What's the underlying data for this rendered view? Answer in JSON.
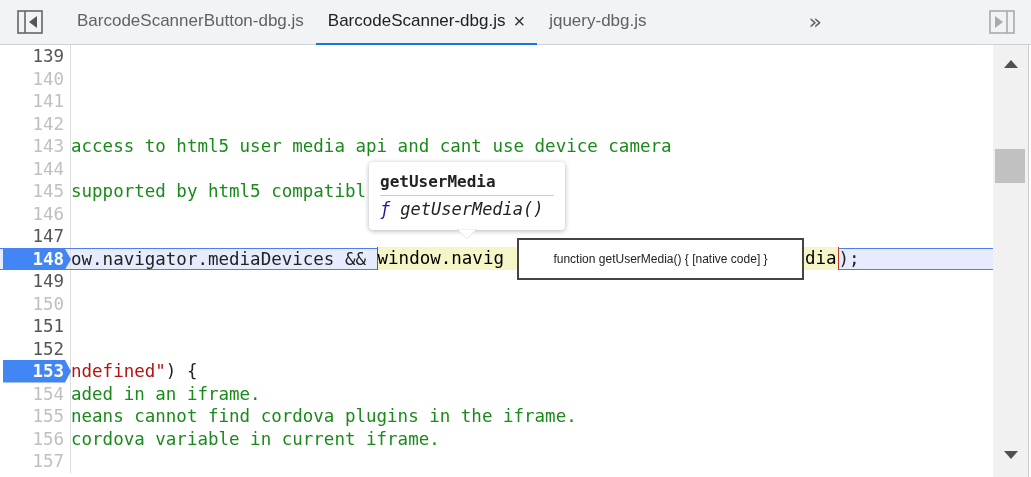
{
  "tabs": [
    {
      "label": "BarcodeScannerButton-dbg.js",
      "selected": false,
      "closable": false
    },
    {
      "label": "BarcodeScanner-dbg.js",
      "selected": true,
      "closable": true,
      "close_glyph": "×"
    },
    {
      "label": "jquery-dbg.js",
      "selected": false,
      "closable": false
    }
  ],
  "more_tabs": "»",
  "lines": [
    {
      "number": "139",
      "dimmed": false,
      "breakpoint": false,
      "current": false
    },
    {
      "number": "140",
      "dimmed": true,
      "breakpoint": false,
      "current": false
    },
    {
      "number": "141",
      "dimmed": true,
      "breakpoint": false,
      "current": false
    },
    {
      "number": "142",
      "dimmed": true,
      "breakpoint": false,
      "current": false
    },
    {
      "number": "143",
      "dimmed": true,
      "breakpoint": false,
      "current": false,
      "segments": [
        {
          "kind": "comment",
          "text": "access to html5 user media api and cant use device camera"
        }
      ]
    },
    {
      "number": "144",
      "dimmed": true,
      "breakpoint": false,
      "current": false
    },
    {
      "number": "145",
      "dimmed": true,
      "breakpoint": false,
      "current": false,
      "segments": [
        {
          "kind": "comment",
          "text": "supported by html5 compatibl"
        }
      ]
    },
    {
      "number": "146",
      "dimmed": true,
      "breakpoint": false,
      "current": false
    },
    {
      "number": "147",
      "dimmed": false,
      "breakpoint": false,
      "current": false
    },
    {
      "number": "148",
      "dimmed": false,
      "breakpoint": true,
      "current": true,
      "segments": [
        {
          "kind": "plain",
          "text": "ow.navigator.mediaDevices && "
        },
        {
          "kind": "match",
          "text": "window.navig",
          "text_end": "dia"
        },
        {
          "kind": "plain",
          "text": ");"
        }
      ]
    },
    {
      "number": "149",
      "dimmed": false,
      "breakpoint": false,
      "current": false
    },
    {
      "number": "150",
      "dimmed": true,
      "breakpoint": false,
      "current": false
    },
    {
      "number": "151",
      "dimmed": false,
      "breakpoint": false,
      "current": false
    },
    {
      "number": "152",
      "dimmed": false,
      "breakpoint": false,
      "current": false
    },
    {
      "number": "153",
      "dimmed": false,
      "breakpoint": true,
      "current": false,
      "segments": [
        {
          "kind": "string",
          "text": "ndefined\""
        },
        {
          "kind": "plain",
          "text": ") {"
        }
      ]
    },
    {
      "number": "154",
      "dimmed": true,
      "breakpoint": false,
      "current": false,
      "segments": [
        {
          "kind": "comment",
          "text": "aded in an iframe."
        }
      ]
    },
    {
      "number": "155",
      "dimmed": true,
      "breakpoint": false,
      "current": false,
      "segments": [
        {
          "kind": "comment",
          "text": "neans cannot find cordova plugins in the iframe."
        }
      ]
    },
    {
      "number": "156",
      "dimmed": true,
      "breakpoint": false,
      "current": false,
      "segments": [
        {
          "kind": "comment",
          "text": "cordova variable in current iframe."
        }
      ]
    },
    {
      "number": "157",
      "dimmed": true,
      "breakpoint": false,
      "current": false
    }
  ],
  "popover": {
    "title": "getUserMedia",
    "function_glyph": "ƒ",
    "signature": "getUserMedia()"
  },
  "tooltip": "function getUserMedia() { [native code] }"
}
